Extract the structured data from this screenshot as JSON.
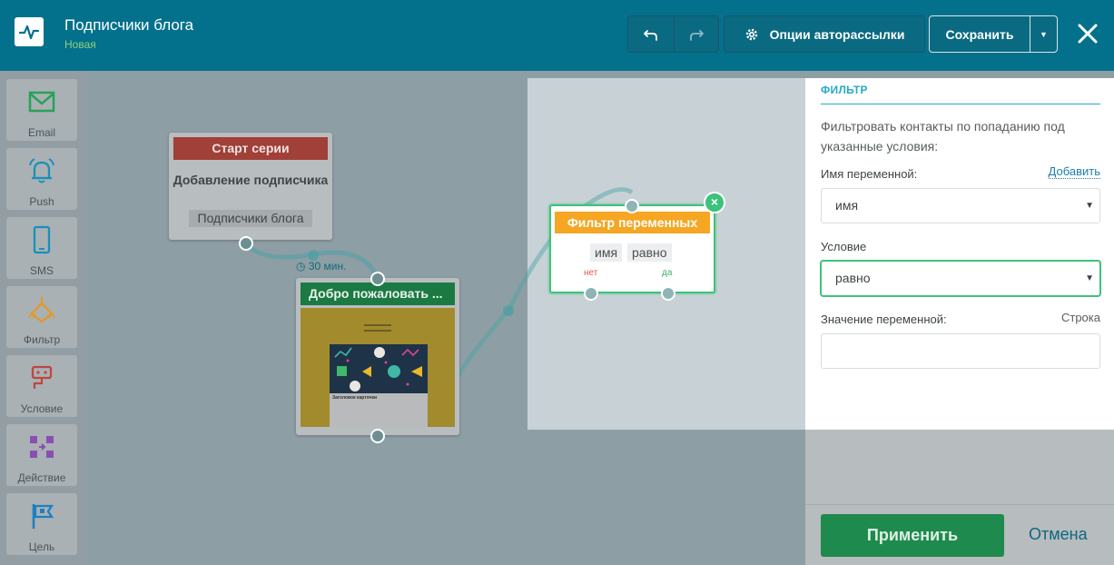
{
  "header": {
    "title": "Подписчики блога",
    "subtitle": "Новая",
    "options_label": "Опции авторассылки",
    "save_label": "Сохранить"
  },
  "sidebar": {
    "items": [
      {
        "label": "Email",
        "icon": "envelope-icon",
        "color": "#2aa05a"
      },
      {
        "label": "Push",
        "icon": "bell-icon",
        "color": "#1a90b8"
      },
      {
        "label": "SMS",
        "icon": "phone-icon",
        "color": "#1a90b8"
      },
      {
        "label": "Фильтр",
        "icon": "filter-icon",
        "color": "#e09a2a"
      },
      {
        "label": "Условие",
        "icon": "condition-icon",
        "color": "#c0463e"
      },
      {
        "label": "Действие",
        "icon": "action-icon",
        "color": "#8a4fb0"
      },
      {
        "label": "Цель",
        "icon": "flag-icon",
        "color": "#1f7fc0"
      }
    ]
  },
  "canvas": {
    "start_node": {
      "header": "Старт серии",
      "title": "Добавление подписчика",
      "tag": "Подписчики блога"
    },
    "delay": "30 мин.",
    "welcome_node": {
      "header": "Добро пожаловать ...",
      "thumb_caption": "Заголовок карточки"
    },
    "filter_node": {
      "header": "Фильтр переменных",
      "chip_name": "имя",
      "chip_cond": "равно",
      "no_label": "нет",
      "yes_label": "да"
    }
  },
  "panel": {
    "section_title": "ФИЛЬТР",
    "description": "Фильтровать контакты по попаданию под указанные условия:",
    "var_name_label": "Имя переменной:",
    "add_link": "Добавить",
    "var_name_value": "имя",
    "condition_label": "Условие",
    "condition_value": "равно",
    "var_value_label": "Значение переменной:",
    "var_type": "Строка",
    "var_value": "",
    "apply_label": "Применить",
    "cancel_label": "Отмена"
  },
  "colors": {
    "header_bg": "#04718c",
    "accent_green": "#3cc27a",
    "filter_orange": "#f5a623",
    "start_red": "#a04038",
    "welcome_green": "#1b7a42"
  }
}
